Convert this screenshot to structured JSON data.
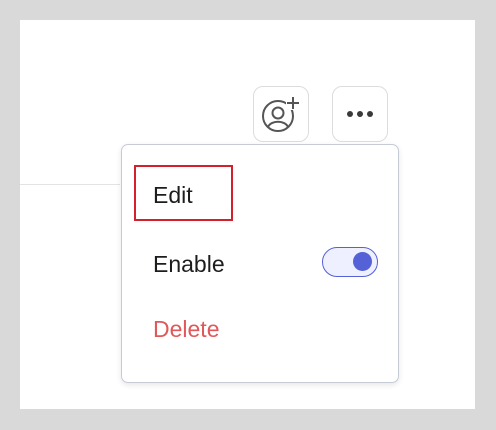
{
  "toolbar": {
    "add_user_icon": "user-add-icon",
    "more_icon": "ellipsis-icon"
  },
  "menu": {
    "edit_label": "Edit",
    "enable_label": "Enable",
    "enable_state": true,
    "delete_label": "Delete"
  },
  "colors": {
    "accent": "#5561d6",
    "danger": "#e0595a",
    "highlight": "#d4202a"
  }
}
